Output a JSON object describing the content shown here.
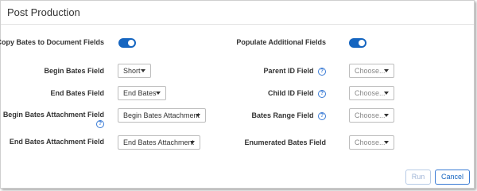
{
  "dialog": {
    "title": "Post Production"
  },
  "left": {
    "copy_bates_label": "Copy Bates to Document Fields",
    "copy_bates_toggle": true,
    "begin_bates_label": "Begin Bates Field",
    "begin_bates_value": "Short",
    "end_bates_label": "End Bates Field",
    "end_bates_value": "End Bates",
    "begin_attach_label": "Begin Bates Attachment Field",
    "begin_attach_value": "Begin Bates Attachment",
    "end_attach_label": "End Bates Attachment Field",
    "end_attach_value": "End Bates Attachment"
  },
  "right": {
    "populate_label": "Populate Additional Fields",
    "populate_toggle": true,
    "parent_id_label": "Parent ID Field",
    "parent_id_placeholder": "Choose...",
    "child_id_label": "Child ID Field",
    "child_id_placeholder": "Choose...",
    "range_label": "Bates Range Field",
    "range_placeholder": "Choose...",
    "enumerated_label": "Enumerated Bates Field",
    "enumerated_placeholder": "Choose..."
  },
  "footer": {
    "run_label": "Run",
    "cancel_label": "Cancel"
  },
  "icons": {
    "help": "?"
  },
  "colors": {
    "accent": "#1565c0",
    "help": "#3a7bd5",
    "disabled": "#9fb5d6"
  }
}
